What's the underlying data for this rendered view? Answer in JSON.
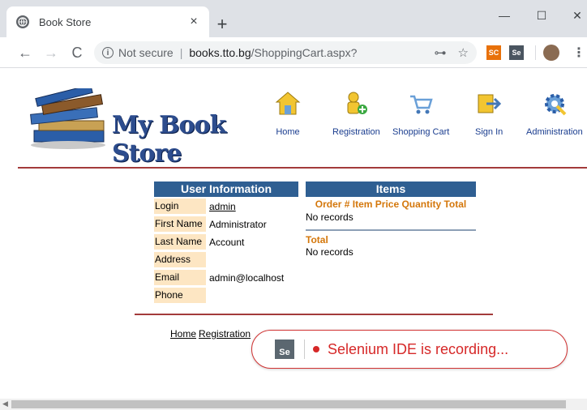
{
  "browser": {
    "tab_title": "Book Store",
    "tab_close": "×",
    "new_tab": "+",
    "minimize": "—",
    "maximize": "☐",
    "close": "✕",
    "back": "←",
    "forward": "→",
    "reload": "C",
    "security_label": "Not secure",
    "url_host": "books.tto.bg",
    "url_path": "/ShoppingCart.aspx?",
    "extensions": [
      "SC",
      "Se"
    ]
  },
  "site": {
    "logo_text": "My Book Store",
    "nav": [
      {
        "label": "Home",
        "icon": "home-icon"
      },
      {
        "label": "Registration",
        "icon": "registration-icon"
      },
      {
        "label": "Shopping Cart",
        "icon": "shopping-cart-icon"
      },
      {
        "label": "Sign In",
        "icon": "sign-in-icon"
      },
      {
        "label": "Administration",
        "icon": "administration-icon"
      }
    ]
  },
  "user_info": {
    "title": "User Information",
    "rows": [
      {
        "label": "Login",
        "value": "admin"
      },
      {
        "label": "First Name",
        "value": "Administrator"
      },
      {
        "label": "Last Name",
        "value": "Account"
      },
      {
        "label": "Address",
        "value": ""
      },
      {
        "label": "Email",
        "value": "admin@localhost"
      },
      {
        "label": "Phone",
        "value": ""
      }
    ]
  },
  "items": {
    "title": "Items",
    "columns": "Order # Item Price Quantity Total",
    "empty_text": "No records",
    "total_label": "Total",
    "total_empty": "No records"
  },
  "footer": {
    "links": [
      "Home",
      "Registration"
    ]
  },
  "selenium": {
    "logo": "Se",
    "message": "Selenium IDE is recording..."
  },
  "colors": {
    "panel_header": "#2f5f92",
    "label_bg": "#fde6c3",
    "divider": "#a33b3b",
    "accent_orange": "#d4770b",
    "recording_red": "#d62828"
  }
}
